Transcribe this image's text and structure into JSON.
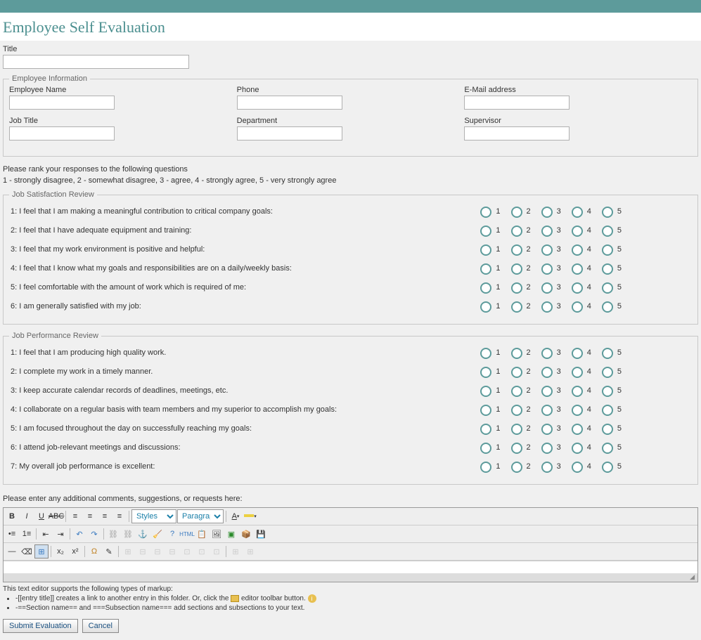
{
  "page_title": "Employee Self Evaluation",
  "title_field": {
    "label": "Title",
    "value": ""
  },
  "emp_info": {
    "legend": "Employee Information",
    "fields": {
      "name": {
        "label": "Employee Name",
        "value": ""
      },
      "phone": {
        "label": "Phone",
        "value": ""
      },
      "email": {
        "label": "E-Mail address",
        "value": ""
      },
      "job_title": {
        "label": "Job Title",
        "value": ""
      },
      "department": {
        "label": "Department",
        "value": ""
      },
      "supervisor": {
        "label": "Supervisor",
        "value": ""
      }
    }
  },
  "instructions": {
    "line1": "Please rank your responses to the following questions",
    "line2": "1 - strongly disagree, 2 - somewhat disagree, 3 - agree, 4 - strongly agree, 5 - very strongly agree"
  },
  "scale": [
    "1",
    "2",
    "3",
    "4",
    "5"
  ],
  "satisfaction": {
    "legend": "Job Satisfaction Review",
    "items": [
      "1: I feel that I am making a meaningful contribution to critical company goals:",
      "2: I feel that I have adequate equipment and training:",
      "3: I feel that my work environment is positive and helpful:",
      "4: I feel that I know what my goals and responsibilities are on a daily/weekly basis:",
      "5: I feel comfortable with the amount of work which is required of me:",
      "6: I am generally satisfied with my job:"
    ]
  },
  "performance": {
    "legend": "Job Performance Review",
    "items": [
      "1: I feel that I am producing high quality work.",
      "2: I complete my work in a timely manner.",
      "3: I keep accurate calendar records of deadlines, meetings, etc.",
      "4: I collaborate on a regular basis with team members and my superior to accomplish my goals:",
      "5: I am focused throughout the day on successfully reaching my goals:",
      "6: I attend job-relevant meetings and discussions:",
      "7: My overall job performance is excellent:"
    ]
  },
  "comments": {
    "label": "Please enter any additional comments, suggestions, or requests here:",
    "styles_option": "Styles",
    "paragraph_option": "Paragraph"
  },
  "help": {
    "intro": "This text editor supports the following types of markup:",
    "li1a": "-[[entry title]] creates a link to another entry in this folder. Or, click the ",
    "li1b": " editor toolbar button. ",
    "li2": "-==Section name== and ===Subsection name=== add sections and subsections to your text."
  },
  "buttons": {
    "submit": "Submit Evaluation",
    "cancel": "Cancel"
  }
}
